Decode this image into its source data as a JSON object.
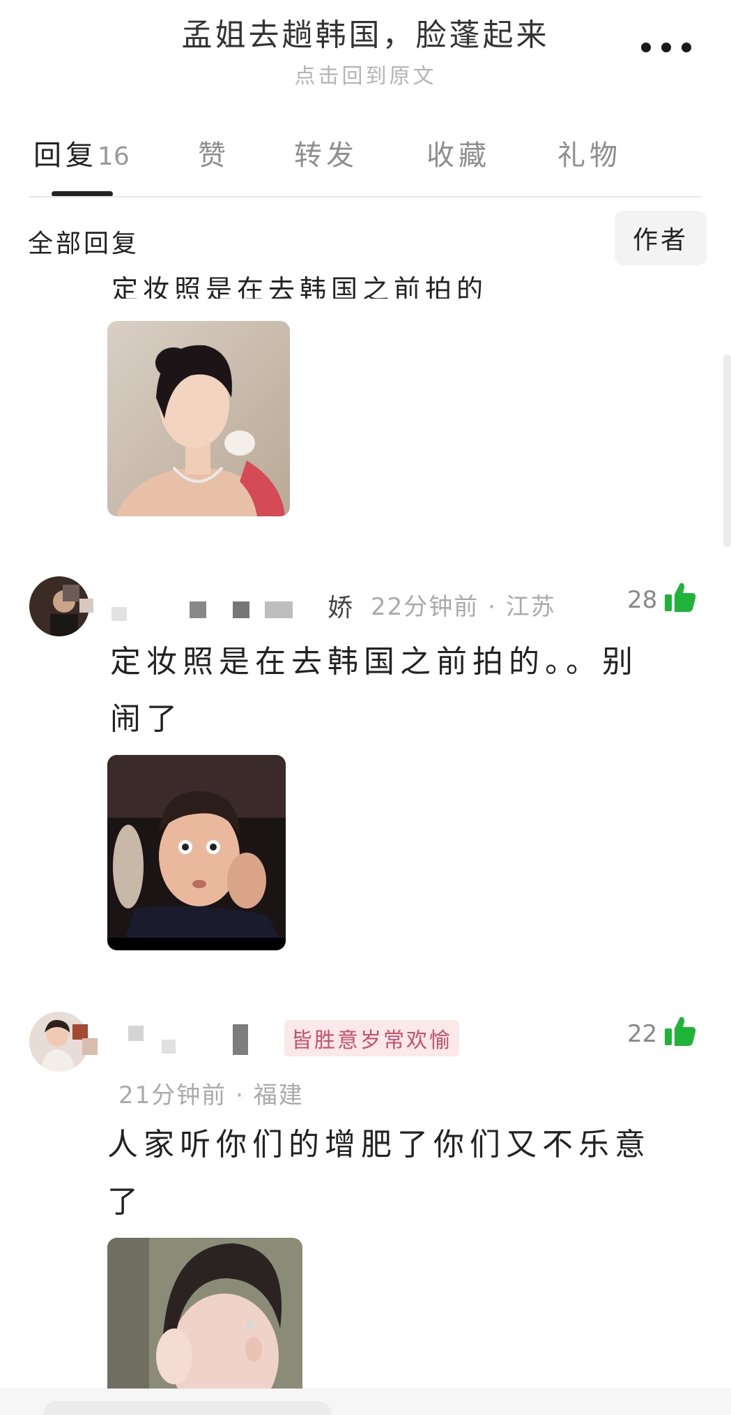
{
  "header": {
    "title": "孟姐去趟韩国，脸蓬起来",
    "subtitle": "点击回到原文",
    "more_icon": "more-dots-icon"
  },
  "tabs": [
    {
      "label": "回复",
      "count": "16",
      "active": true
    },
    {
      "label": "赞"
    },
    {
      "label": "转发"
    },
    {
      "label": "收藏"
    },
    {
      "label": "礼物"
    }
  ],
  "filter": {
    "all_replies_label": "全部回复",
    "author_button": "作者"
  },
  "partial_comment": {
    "text": "定妆照是在去韩国之前拍的"
  },
  "comments": [
    {
      "name_visible": "娇",
      "time": "22分钟前",
      "location": "江苏",
      "likes": "28",
      "text_line1": "定妆照是在去韩国之前拍的。。别",
      "text_line2": "闹了"
    },
    {
      "badge": "皆胜意岁常欢愉",
      "time": "21分钟前",
      "location": "福建",
      "likes": "22",
      "text_line1": "人家听你们的增肥了你们又不乐意",
      "text_line2": "了"
    }
  ],
  "colors": {
    "like_green": "#1fb33a",
    "badge_bg": "#fbe9ea",
    "badge_text": "#c7506b"
  }
}
